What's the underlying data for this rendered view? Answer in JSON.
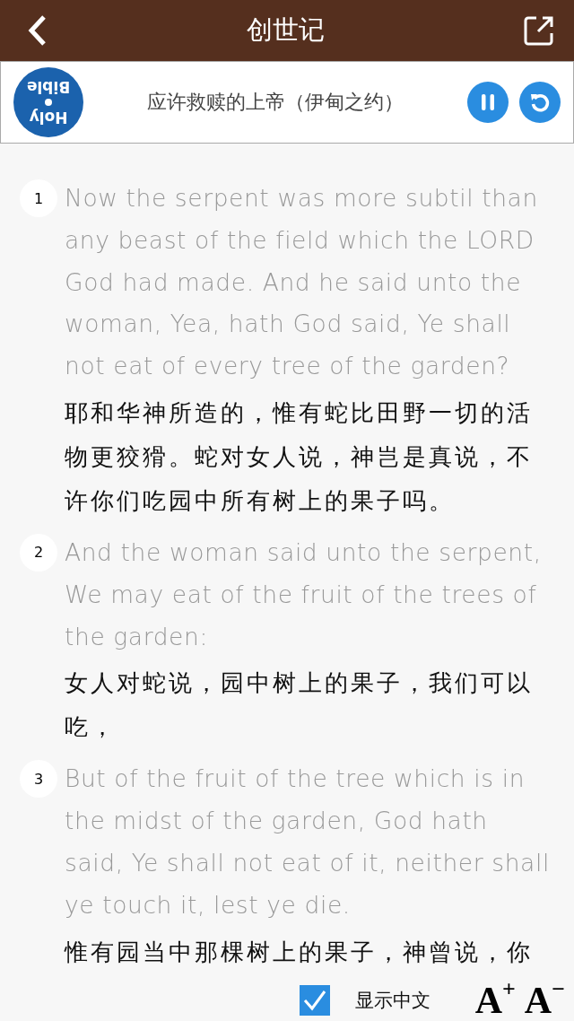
{
  "header": {
    "title": "创世记"
  },
  "now_playing": {
    "logo": {
      "top": "Holy",
      "bottom": "Bible"
    },
    "title": "应许救赎的上帝（伊甸之约）"
  },
  "verses": [
    {
      "number": "1",
      "english": "Now the serpent was more subtil than any beast of the field which the LORD God had made. And he said unto the woman, Yea, hath God said, Ye shall not eat of every tree of the garden?",
      "chinese": "耶和华神所造的，惟有蛇比田野一切的活物更狡猾。蛇对女人说，神岂是真说，不许你们吃园中所有树上的果子吗。"
    },
    {
      "number": "2",
      "english": "And the woman said unto the serpent, We may eat of the fruit of the trees of the garden:",
      "chinese": "女人对蛇说，园中树上的果子，我们可以吃，"
    },
    {
      "number": "3",
      "english": "But of the fruit of the tree which is in the midst of the garden, God hath said, Ye shall not eat of it, neither shall ye touch it, lest ye die.",
      "chinese": "惟有园当中那棵树上的果子，神曾说，你"
    }
  ],
  "footer": {
    "show_chinese": {
      "label": "显示中文",
      "checked": true
    },
    "font_up": "A$^{+}$",
    "font_down": "A$^{−}$"
  }
}
